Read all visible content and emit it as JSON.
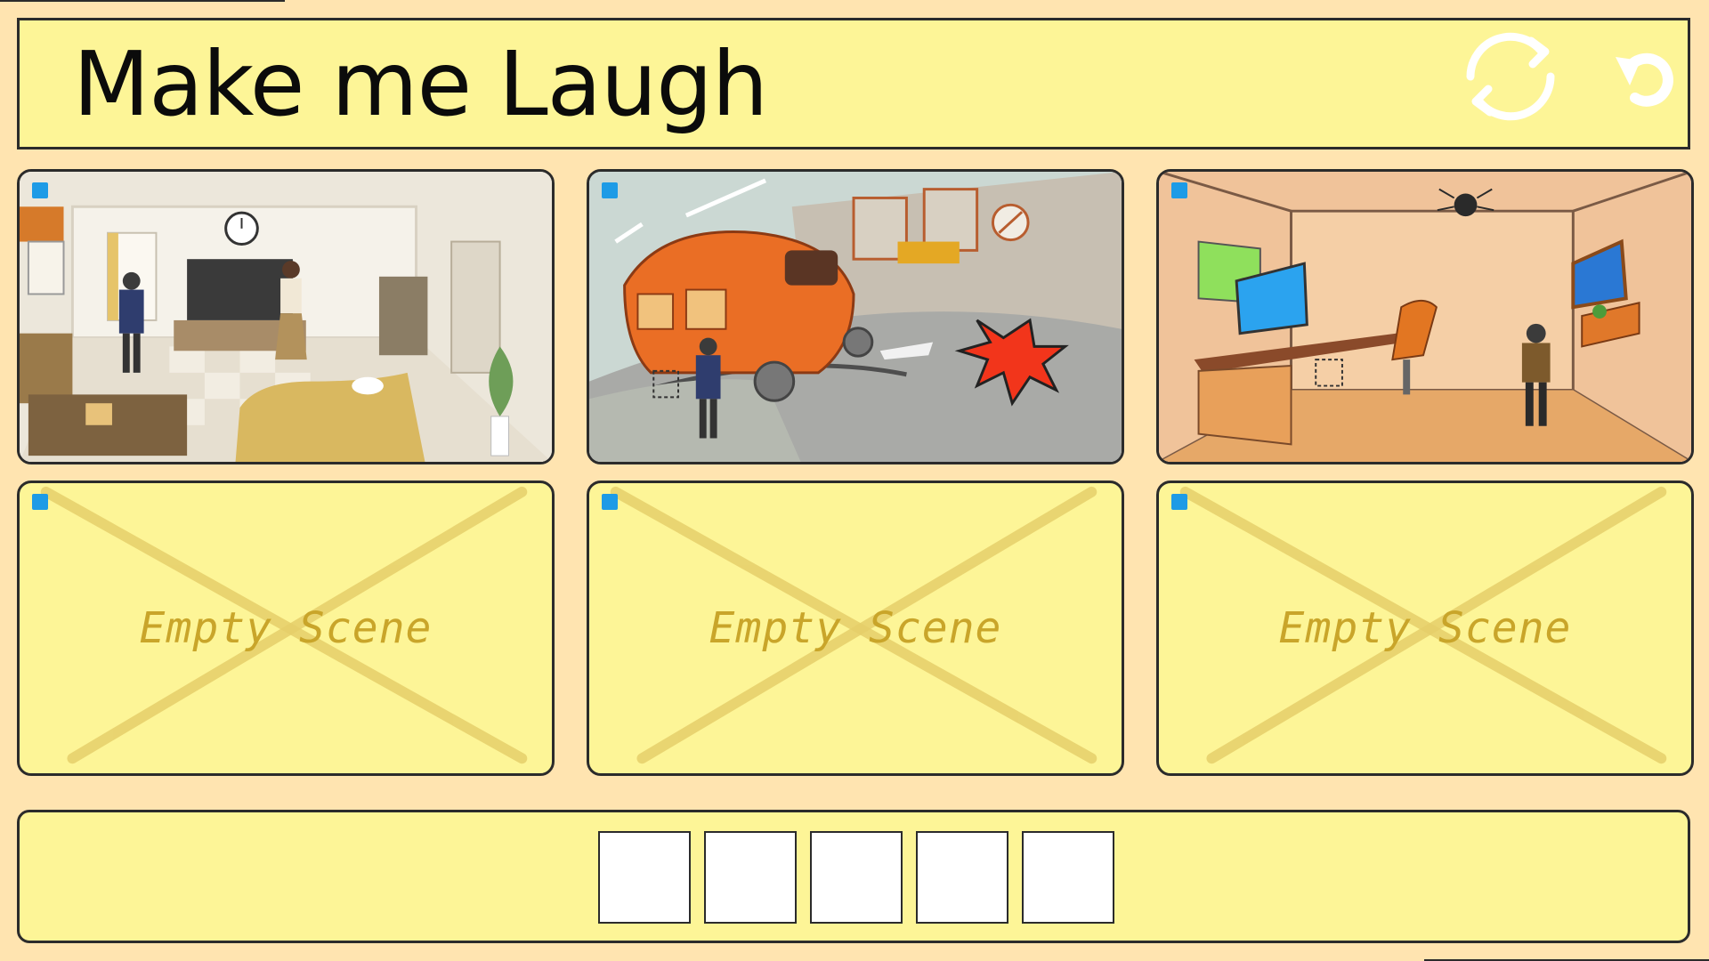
{
  "header": {
    "title": "Make me Laugh",
    "refresh_icon": "refresh-icon",
    "undo_icon": "undo-icon"
  },
  "scenes": [
    {
      "kind": "living-room",
      "selected_marker": true
    },
    {
      "kind": "street-crash",
      "selected_marker": true
    },
    {
      "kind": "office-spider",
      "selected_marker": true
    },
    {
      "kind": "empty",
      "label": "Empty Scene",
      "selected_marker": true
    },
    {
      "kind": "empty",
      "label": "Empty Scene",
      "selected_marker": true
    },
    {
      "kind": "empty",
      "label": "Empty Scene",
      "selected_marker": true
    }
  ],
  "tray": {
    "slot_count": 5
  },
  "colors": {
    "background": "#ffe4b0",
    "panel": "#fdf597",
    "border": "#2b2b2b",
    "marker": "#1e9be6",
    "empty_text": "#c9a52a"
  }
}
